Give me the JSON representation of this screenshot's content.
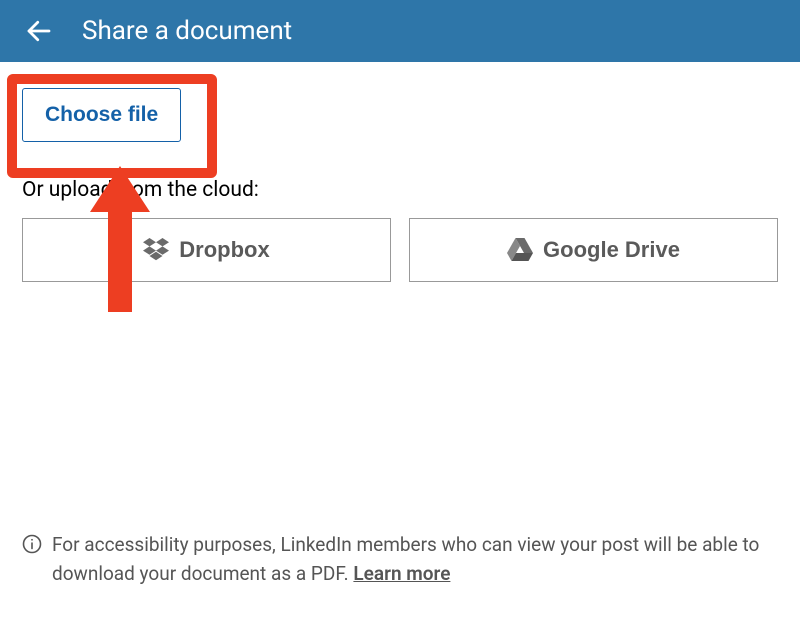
{
  "header": {
    "title": "Share a document"
  },
  "upload": {
    "choose_file_label": "Choose file",
    "cloud_label": "Or upload from the cloud:",
    "dropbox_label": "Dropbox",
    "google_drive_label": "Google Drive"
  },
  "footer": {
    "note": "For accessibility purposes, LinkedIn members who can view your post will be able to download your document as a PDF. ",
    "learn_more": "Learn more"
  },
  "annotation": {
    "highlight_color": "#ed3e22"
  }
}
